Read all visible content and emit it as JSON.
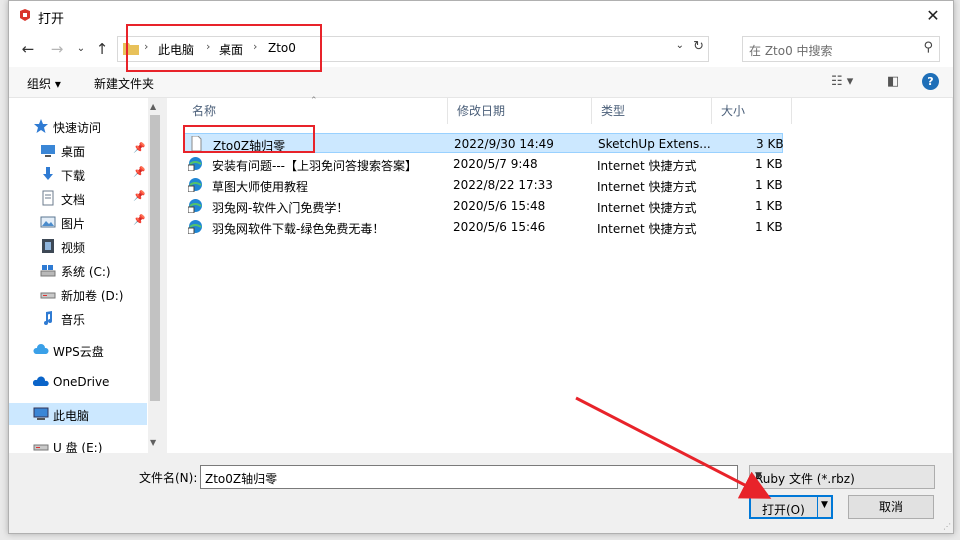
{
  "window": {
    "title": "打开",
    "close_label": "✕"
  },
  "address": {
    "crumbs": [
      "此电脑",
      "桌面",
      "Zto0"
    ],
    "search_placeholder": "在 Zto0 中搜索"
  },
  "toolbar": {
    "organize": "组织 ▾",
    "new_folder": "新建文件夹",
    "help": "?"
  },
  "nav": {
    "items": [
      {
        "label": "快速访问",
        "icon": "star-icon"
      },
      {
        "label": "桌面",
        "icon": "desktop-icon",
        "pinned": true
      },
      {
        "label": "下载",
        "icon": "download-icon",
        "pinned": true
      },
      {
        "label": "文档",
        "icon": "document-icon",
        "pinned": true
      },
      {
        "label": "图片",
        "icon": "picture-icon",
        "pinned": true
      },
      {
        "label": "视频",
        "icon": "video-icon"
      },
      {
        "label": "系统 (C:)",
        "icon": "drive-icon"
      },
      {
        "label": "新加卷 (D:)",
        "icon": "drive-icon"
      },
      {
        "label": "音乐",
        "icon": "music-icon"
      },
      {
        "label": "WPS云盘",
        "icon": "cloud-icon"
      },
      {
        "label": "OneDrive",
        "icon": "cloud-icon"
      },
      {
        "label": "此电脑",
        "icon": "computer-icon",
        "selected": true
      },
      {
        "label": "U 盘 (E:)",
        "icon": "usb-drive-icon"
      }
    ]
  },
  "columns": [
    "名称",
    "修改日期",
    "类型",
    "大小"
  ],
  "files": [
    {
      "name": "Zto0Z轴归零",
      "date": "2022/9/30 14:49",
      "type": "SketchUp Extens...",
      "size": "3 KB",
      "icon": "file-icon",
      "selected": true
    },
    {
      "name": "安装有问题---【上羽免问答搜索答案】",
      "date": "2020/5/7 9:48",
      "type": "Internet 快捷方式",
      "size": "1 KB",
      "icon": "internet-shortcut-icon"
    },
    {
      "name": "草图大师使用教程",
      "date": "2022/8/22 17:33",
      "type": "Internet 快捷方式",
      "size": "1 KB",
      "icon": "internet-shortcut-icon"
    },
    {
      "name": "羽兔网-软件入门免费学！",
      "date": "2020/5/6 15:48",
      "type": "Internet 快捷方式",
      "size": "1 KB",
      "icon": "internet-shortcut-icon"
    },
    {
      "name": "羽兔网软件下载-绿色免费无毒！",
      "date": "2020/5/6 15:46",
      "type": "Internet 快捷方式",
      "size": "1 KB",
      "icon": "internet-shortcut-icon"
    }
  ],
  "bottom": {
    "filename_label": "文件名(N):",
    "filename_value": "Zto0Z轴归零",
    "filetype": "Ruby 文件 (*.rbz)",
    "open_label": "打开(O)",
    "cancel_label": "取消"
  },
  "colors": {
    "accent": "#0078d7",
    "selection": "#cce8ff",
    "annotation": "#e8232a"
  }
}
